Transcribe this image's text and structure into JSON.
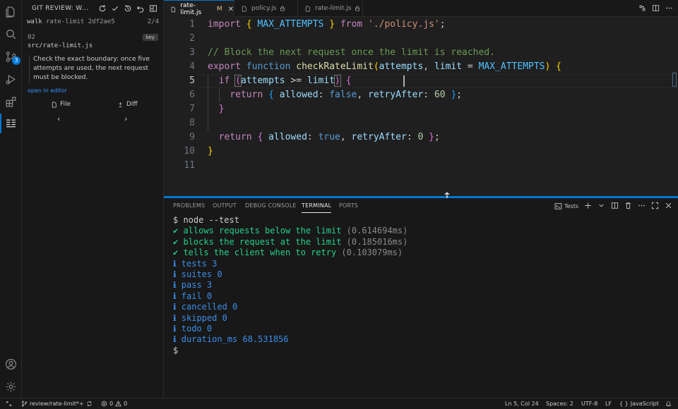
{
  "activity": {
    "scm_badge": "3"
  },
  "sidebar": {
    "title": "GIT REVIEW: WALKTHROUGH",
    "walk_label": "walk",
    "walk_name": "rate-limit 2df2ae5",
    "position": "2/4",
    "step_number": "02",
    "step_tag": "key",
    "file_path": "src/rate-limit.js",
    "note": "Check the exact boundary: once five attempts are used, the next request must be blocked.",
    "open_link": "open in editor",
    "file_button": "File",
    "diff_button": "Diff",
    "prev": "‹",
    "next": "›"
  },
  "tabs": [
    {
      "label": "rate-limit.js",
      "modified": "M",
      "active": true
    },
    {
      "label": "policy.js",
      "locked": true
    },
    {
      "label": "rate-limit.js",
      "locked": true
    }
  ],
  "editor": {
    "cursor_line": 5,
    "line_numbers": [
      "1",
      "2",
      "3",
      "4",
      "5",
      "6",
      "7",
      "8",
      "9",
      "10",
      "11"
    ]
  },
  "panel": {
    "tabs": [
      "PROBLEMS",
      "OUTPUT",
      "DEBUG CONSOLE",
      "TERMINAL",
      "PORTS"
    ],
    "active_tab": "TERMINAL",
    "terminal_name": "Tests",
    "terminal_lines": [
      {
        "kind": "prompt",
        "text": "$ node --test"
      },
      {
        "kind": "ok",
        "text": "✔ allows requests below the limit",
        "time": "(0.614694ms)"
      },
      {
        "kind": "ok",
        "text": "✔ blocks the request at the limit",
        "time": "(0.185016ms)"
      },
      {
        "kind": "ok",
        "text": "✔ tells the client when to retry",
        "time": "(0.103079ms)"
      },
      {
        "kind": "info",
        "text": "ℹ tests 3"
      },
      {
        "kind": "info",
        "text": "ℹ suites 0"
      },
      {
        "kind": "info",
        "text": "ℹ pass 3"
      },
      {
        "kind": "info",
        "text": "ℹ fail 0"
      },
      {
        "kind": "info",
        "text": "ℹ cancelled 0"
      },
      {
        "kind": "info",
        "text": "ℹ skipped 0"
      },
      {
        "kind": "info",
        "text": "ℹ todo 0"
      },
      {
        "kind": "info",
        "text": "ℹ duration_ms 68.531856"
      },
      {
        "kind": "prompt",
        "text": "$ "
      }
    ]
  },
  "status": {
    "branch": "review/rate-limit*+",
    "errors": "0",
    "warnings": "0",
    "cursor": "Ln 5, Col 24",
    "spaces": "Spaces: 2",
    "encoding": "UTF-8",
    "eol": "LF",
    "language": "JavaScript"
  },
  "colors": {
    "accent": "#0078d4",
    "modified": "#e2c08d",
    "pass": "#23d18b",
    "info": "#3b8eea"
  }
}
